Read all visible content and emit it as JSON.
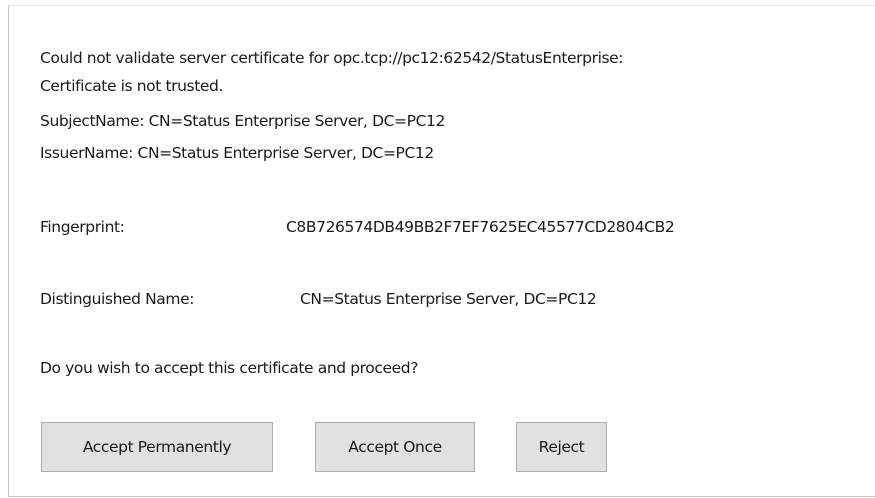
{
  "message": {
    "line1": "Could not validate server certificate for opc.tcp://pc12:62542/StatusEnterprise:",
    "line2": "Certificate is not trusted.",
    "line3": "SubjectName: CN=Status Enterprise Server, DC=PC12",
    "line4": "IssuerName: CN=Status Enterprise Server, DC=PC12"
  },
  "fingerprint": {
    "label": "Fingerprint:",
    "value": "C8B726574DB49BB2F7EF7625EC45577CD2804CB2"
  },
  "distinguished_name": {
    "label": "Distinguished Name:",
    "value": "CN=Status Enterprise Server, DC=PC12"
  },
  "question": "Do you wish to accept this certificate and proceed?",
  "buttons": {
    "accept_permanently": "Accept Permanently",
    "accept_once": "Accept Once",
    "reject": "Reject"
  },
  "colors": {
    "button_background": "#e1e1e1",
    "button_border": "#adadad",
    "text": "#1a1a1a"
  }
}
